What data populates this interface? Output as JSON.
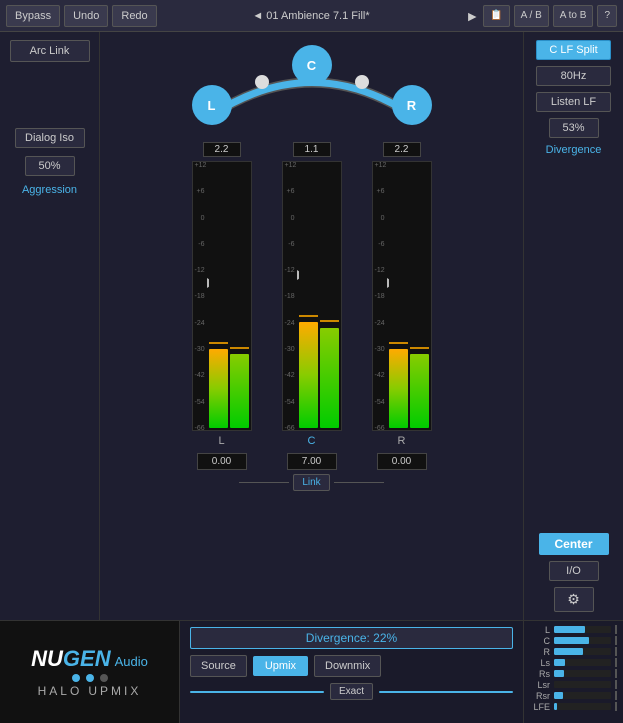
{
  "topbar": {
    "bypass": "Bypass",
    "undo": "Undo",
    "redo": "Redo",
    "title": "◄ 01 Ambience 7.1 Fill*",
    "play": "►",
    "clipboard": "📋",
    "ab": "A / B",
    "atob": "A to B",
    "help": "?"
  },
  "left": {
    "arc_link": "Arc Link",
    "dialog_iso": "Dialog Iso",
    "percent": "50%",
    "aggression": "Aggression"
  },
  "channels": [
    {
      "id": "L",
      "label": "L",
      "value": "2.2",
      "fader": "0.00",
      "meter_pct": 35
    },
    {
      "id": "C",
      "label": "C",
      "value": "1.1",
      "fader": "7.00",
      "meter_pct": 55
    },
    {
      "id": "R",
      "label": "R",
      "value": "2.2",
      "fader": "0.00",
      "meter_pct": 35
    }
  ],
  "meter_scale": [
    "+12",
    "+6",
    "0",
    "-6",
    "-12",
    "-18",
    "-24",
    "-30",
    "-42",
    "-54",
    "-66"
  ],
  "link": "Link",
  "right": {
    "clf_split": "C LF Split",
    "hz": "80Hz",
    "listen_lf": "Listen LF",
    "pct": "53%",
    "divergence": "Divergence",
    "center": "Center",
    "io": "I/O",
    "gear": "⚙"
  },
  "bottom": {
    "nugen": "NU",
    "gen": "GEN",
    "audio": "Audio",
    "halo": "HALO",
    "upmix": "UPMIX",
    "divergence_bar": "Divergence: 22%",
    "source": "Source",
    "upmix_btn": "Upmix",
    "downmix": "Downmix",
    "exact": "Exact"
  },
  "ch_meters": [
    {
      "label": "L",
      "fill": 55
    },
    {
      "label": "C",
      "fill": 60
    },
    {
      "label": "R",
      "fill": 50
    },
    {
      "label": "Ls",
      "fill": 20
    },
    {
      "label": "Rs",
      "fill": 18
    },
    {
      "label": "Lsr",
      "fill": 0
    },
    {
      "label": "Rsr",
      "fill": 15
    },
    {
      "label": "LFE",
      "fill": 5
    }
  ]
}
